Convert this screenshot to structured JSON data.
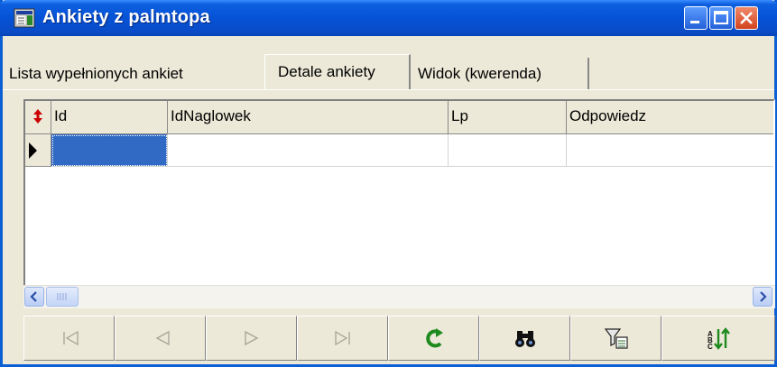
{
  "window": {
    "title": "Ankiety z palmtopa",
    "controls": [
      "minimize-icon",
      "maximize-icon",
      "close-icon"
    ]
  },
  "tabs": [
    {
      "label": "Lista wypełnionych ankiet",
      "active": false
    },
    {
      "label": "Detale ankiety",
      "active": true
    },
    {
      "label": "Widok (kwerenda)",
      "active": false
    }
  ],
  "grid": {
    "columns": [
      "Id",
      "IdNaglowek",
      "Lp",
      "Odpowiedz"
    ],
    "rows": [
      {
        "id": "",
        "idnaglowek": "",
        "lp": "",
        "odpowiedz": ""
      }
    ]
  },
  "navigator": {
    "buttons": [
      "first-record-icon",
      "prior-record-icon",
      "next-record-icon",
      "last-record-icon",
      "refresh-icon",
      "find-icon",
      "filter-icon",
      "sort-icon"
    ]
  },
  "colors": {
    "titlebar": "#0552d6",
    "selection": "#316ac5",
    "face": "#ece9d8"
  }
}
